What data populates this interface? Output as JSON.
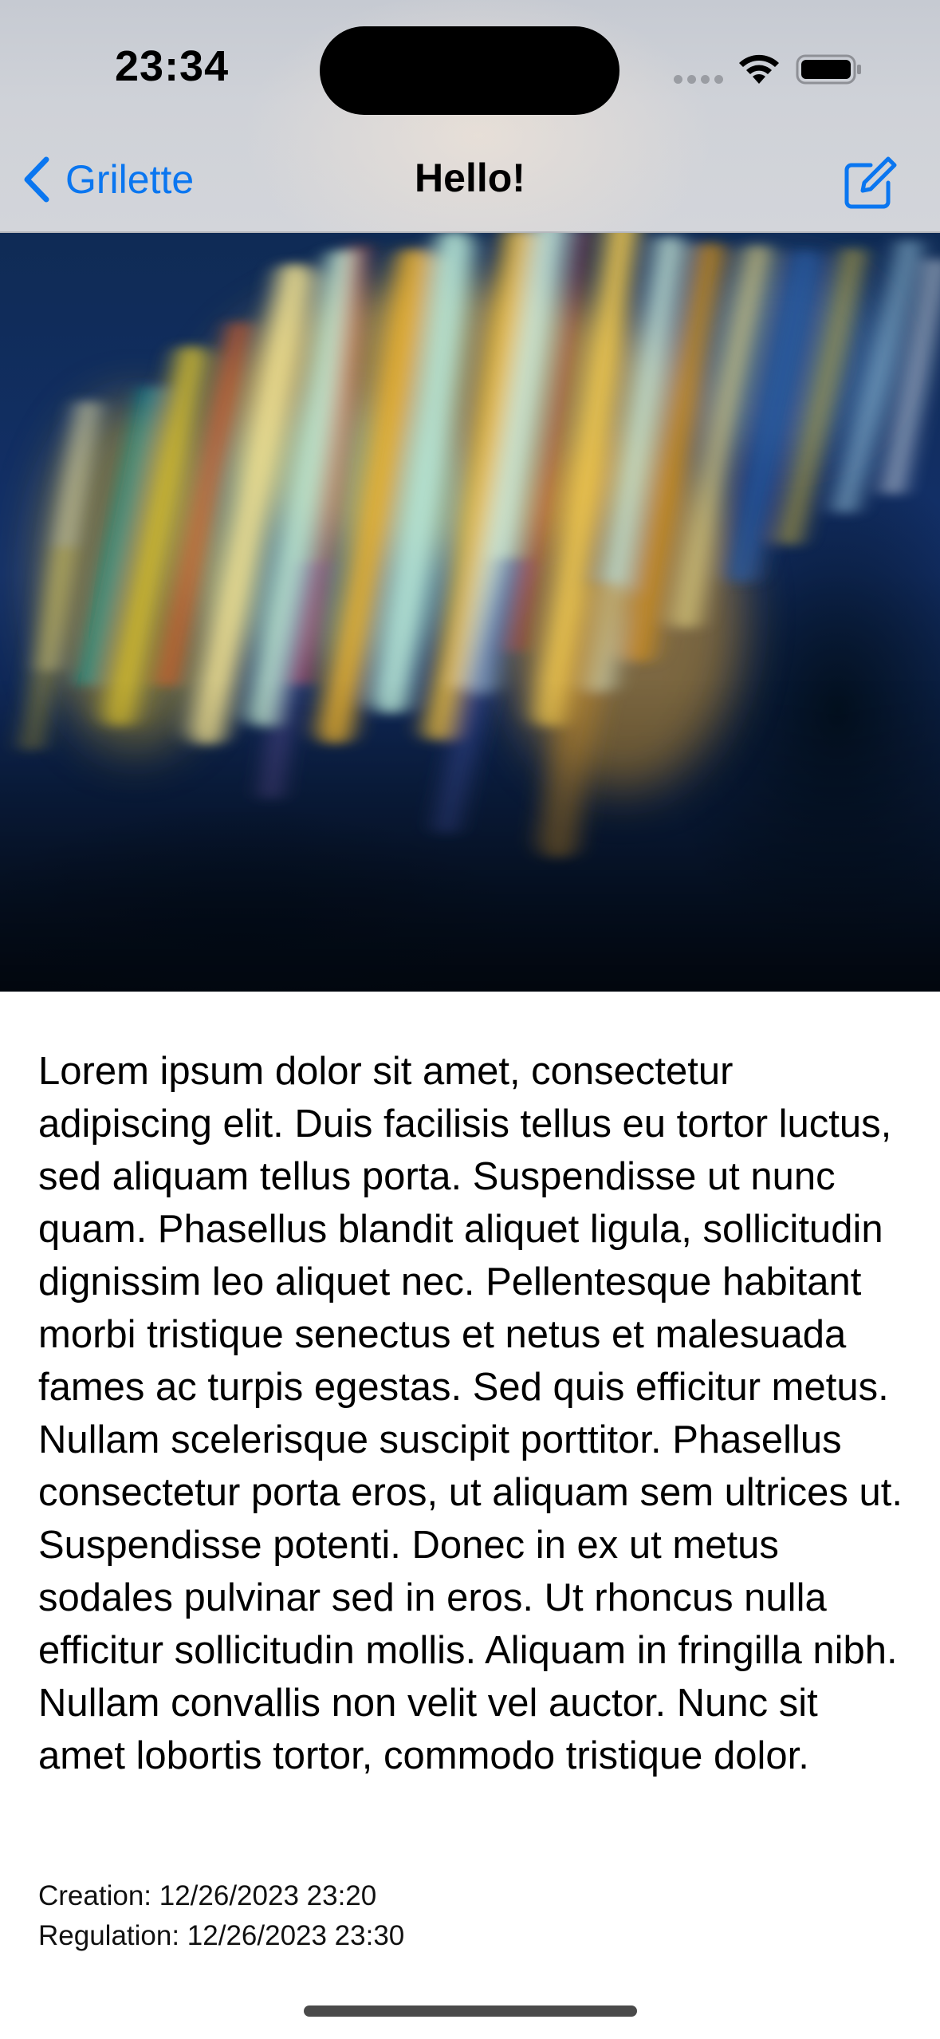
{
  "status_bar": {
    "time": "23:34",
    "icons": [
      "signal-icon",
      "wifi-icon",
      "battery-icon"
    ]
  },
  "nav": {
    "back_label": "Grilette",
    "title": "Hello!",
    "compose_icon": "compose-icon"
  },
  "hero": {
    "image_icon": "photo"
  },
  "note": {
    "body": "Lorem ipsum dolor sit amet, consectetur adipiscing elit. Duis facilisis tellus eu tortor luctus, sed aliquam tellus porta. Suspendisse ut nunc quam. Phasellus blandit aliquet ligula, sollicitudin dignissim leo aliquet nec. Pellentesque habitant morbi tristique senectus et netus et malesuada fames ac turpis egestas. Sed quis efficitur metus. Nullam scelerisque suscipit porttitor. Phasellus consectetur porta eros, ut aliquam sem ultrices ut. Suspendisse potenti. Donec in ex ut metus sodales pulvinar sed in eros. Ut rhoncus nulla efficitur sollicitudin mollis. Aliquam in fringilla nibh. Nullam convallis non velit vel auctor. Nunc sit amet lobortis tortor, commodo tristique dolor.",
    "creation": "Creation: 12/26/2023 23:20",
    "regulation": "Regulation: 12/26/2023 23:30"
  },
  "colors": {
    "accent": "#0a76f0",
    "header_bg": "#cfd2d8",
    "text": "#000000"
  }
}
